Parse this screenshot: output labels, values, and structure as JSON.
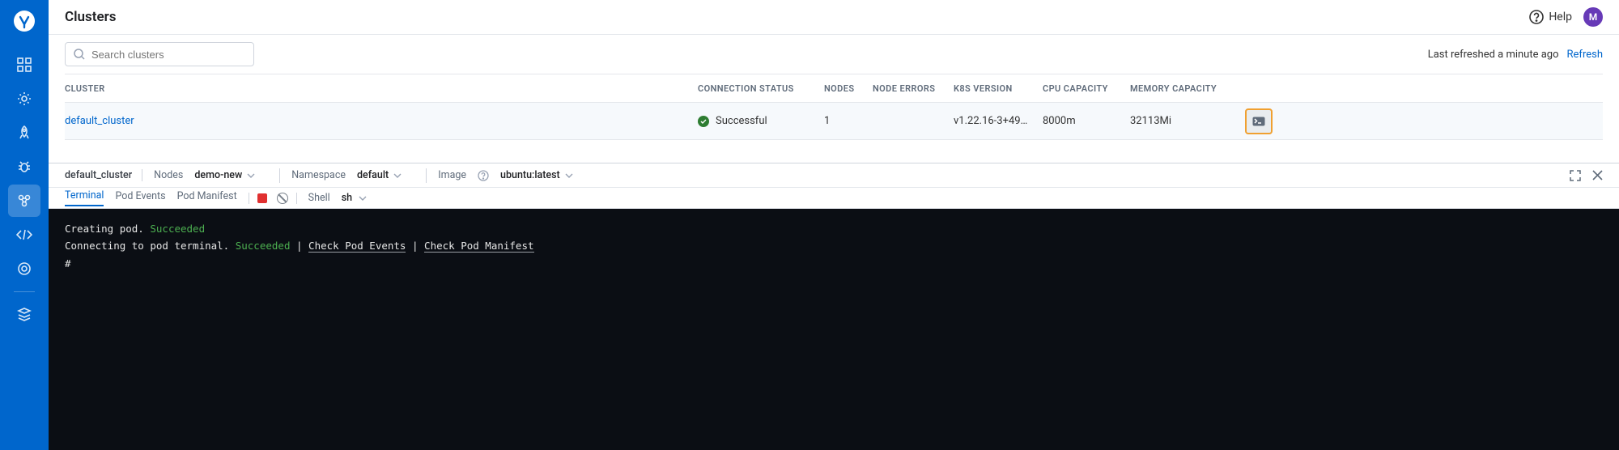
{
  "header": {
    "title": "Clusters",
    "help": "Help",
    "avatar": "M"
  },
  "toolbar": {
    "search_ph": "Search clusters",
    "last_refreshed": "Last refreshed a minute ago",
    "refresh": "Refresh"
  },
  "columns": {
    "cluster": "Cluster",
    "status": "Connection Status",
    "nodes": "Nodes",
    "nerr": "Node Errors",
    "k8s": "K8s Version",
    "cpu": "CPU Capacity",
    "mem": "Memory Capacity"
  },
  "row": {
    "name": "default_cluster",
    "status": "Successful",
    "nodes": "1",
    "nerr": "",
    "k8s": "v1.22.16-3+49…",
    "cpu": "8000m",
    "mem": "32113Mi"
  },
  "panel": {
    "cluster": "default_cluster",
    "nodes_lbl": "Nodes",
    "nodes_val": "demo-new",
    "ns_lbl": "Namespace",
    "ns_val": "default",
    "img_lbl": "Image",
    "img_val": "ubuntu:latest",
    "shell_lbl": "Shell",
    "shell_val": "sh"
  },
  "tabs": {
    "t1": "Terminal",
    "t2": "Pod Events",
    "t3": "Pod Manifest"
  },
  "console": {
    "l1a": "Creating pod.",
    "l1b": "Succeeded",
    "l2a": "Connecting to pod terminal.",
    "l2b": "Succeeded",
    "link1": "Check Pod Events",
    "link2": "Check Pod Manifest",
    "prompt": "#"
  }
}
